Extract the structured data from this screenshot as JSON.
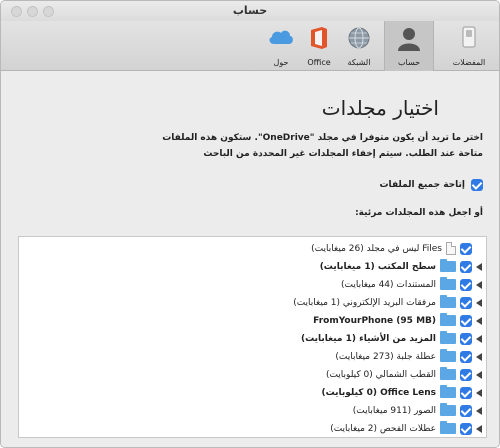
{
  "window": {
    "title": "حساب"
  },
  "toolbar": {
    "items": [
      {
        "label": "المفضلات",
        "icon": "switch-icon"
      },
      {
        "label": "حساب",
        "icon": "person-icon",
        "selected": true
      },
      {
        "label": "الشبكة",
        "icon": "globe-icon"
      },
      {
        "label": "Office",
        "icon": "office-icon"
      },
      {
        "label": "حول",
        "icon": "cloud-icon"
      }
    ]
  },
  "content": {
    "heading": "اختيار مجلدات",
    "description_line1": "اختر ما تريد أن يكون متوفرا في مجلد \"OneDrive\". ستكون هذه الملفات",
    "description_line2": "متاحة عند الطلب. سيتم إخفاء المجلدات غير المحددة من الباحث",
    "select_all_label": "إتاحة جميع الملفات",
    "or_label": "أو اجعل هذه المجلدات مرئية:"
  },
  "folders": [
    {
      "label": "Files ليس في مجلد (26 ميغابايت)",
      "type": "file",
      "bold": false
    },
    {
      "label": "سطح المكتب (1 ميغابايت)",
      "type": "folder",
      "bold": true
    },
    {
      "label": "المستندات (44 ميغابايت)",
      "type": "folder",
      "bold": false
    },
    {
      "label": "مرفقات البريد الإلكتروني (1 ميغابايت)",
      "type": "folder",
      "bold": false
    },
    {
      "label": "FromYourPhone (95 MB)",
      "type": "folder",
      "bold": true
    },
    {
      "label": "المزيد من الأشياء (1 ميغابايت)",
      "type": "folder",
      "bold": true
    },
    {
      "label": "عطلة جلبة (273 ميغابايت)",
      "type": "folder",
      "bold": false
    },
    {
      "label": "القطب الشمالي (0 كيلوبايت)",
      "type": "folder",
      "bold": false
    },
    {
      "label": "Office Lens (0 كيلوبايت)",
      "type": "folder",
      "bold": true
    },
    {
      "label": "الصور (911 ميغابايت)",
      "type": "folder",
      "bold": false
    },
    {
      "label": "عطلات الفحص (2 ميغابايت)",
      "type": "folder",
      "bold": false
    }
  ],
  "colors": {
    "accent": "#2f7ae5",
    "folder": "#5ba7e6"
  }
}
